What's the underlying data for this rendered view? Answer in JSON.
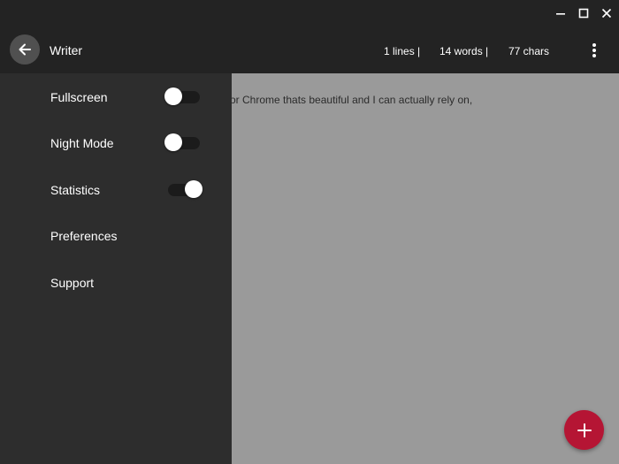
{
  "window": {
    "controls": [
      "minimize-icon",
      "maximize-icon",
      "close-icon"
    ]
  },
  "appbar": {
    "back_icon": "arrow-left-icon",
    "title": "Writer",
    "stats": {
      "lines": "1 lines |",
      "words": "14 words |",
      "chars": "77 chars"
    },
    "menu_icon": "more-vertical-icon"
  },
  "editor": {
    "visible_text": "or Chrome thats beautiful and I can actually rely on,"
  },
  "drawer": {
    "items": [
      {
        "label": "Fullscreen",
        "toggle": true,
        "on": false
      },
      {
        "label": "Night Mode",
        "toggle": true,
        "on": false
      },
      {
        "label": "Statistics",
        "toggle": true,
        "on": true
      },
      {
        "label": "Preferences",
        "toggle": false
      },
      {
        "label": "Support",
        "toggle": false
      }
    ]
  },
  "fab": {
    "icon": "plus-icon",
    "color": "#b51534"
  },
  "colors": {
    "titlebar": "#232323",
    "drawer": "#2d2d2d",
    "editor_overlay": "#9a9a9a",
    "accent": "#b51534"
  }
}
